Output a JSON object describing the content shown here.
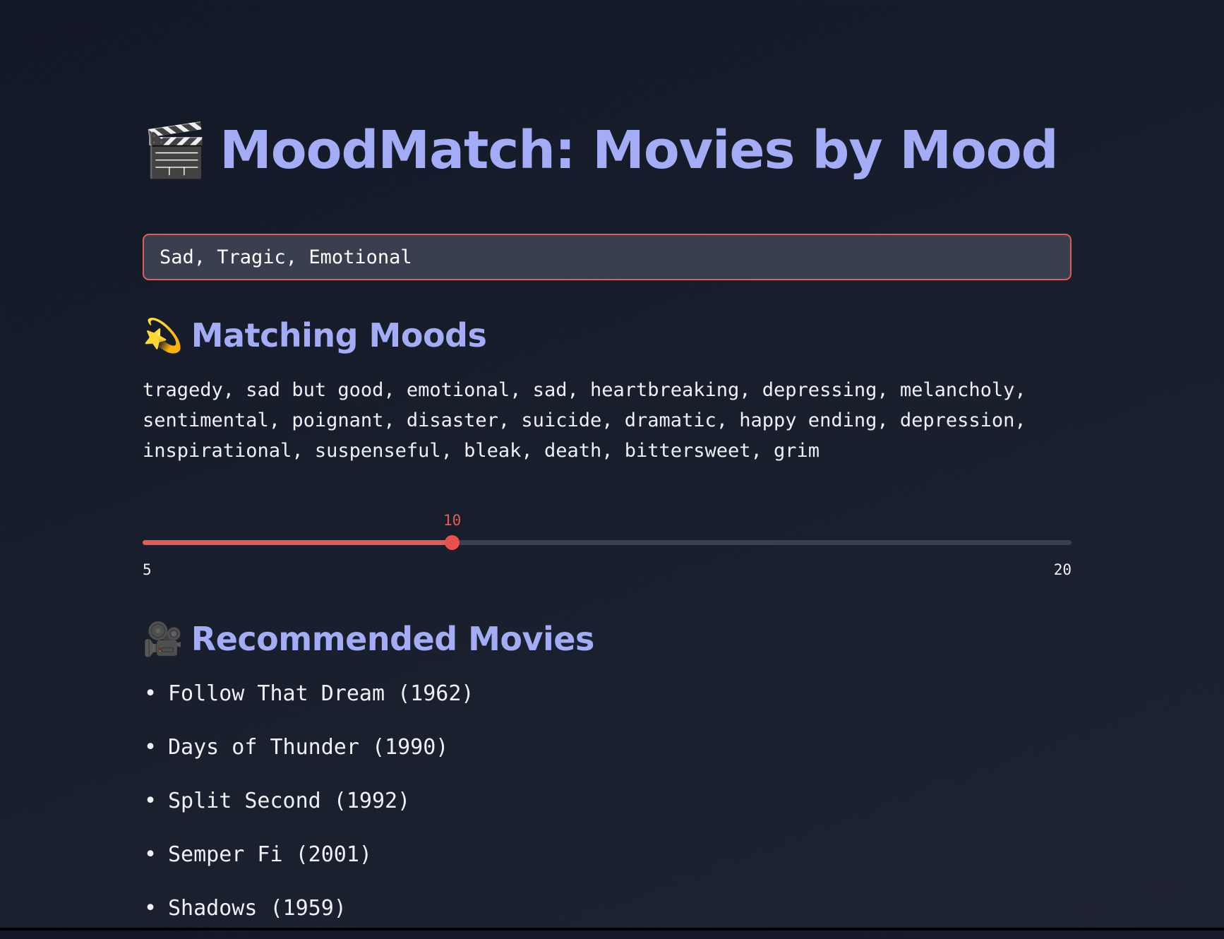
{
  "header": {
    "title_icon": "🎬",
    "title": "MoodMatch: Movies by Mood"
  },
  "search": {
    "value": "Sad, Tragic, Emotional",
    "placeholder": ""
  },
  "matching_moods": {
    "icon": "💫",
    "heading": "Matching Moods",
    "text": "tragedy, sad but good, emotional, sad, heartbreaking, depressing, melancholy, sentimental, poignant, disaster, suicide, dramatic, happy ending, depression, inspirational, suspenseful, bleak, death, bittersweet, grim"
  },
  "slider": {
    "value": 10,
    "value_label": "10",
    "min": 5,
    "min_label": "5",
    "max": 20,
    "max_label": "20"
  },
  "recommended": {
    "icon": "🎥",
    "heading": "Recommended Movies",
    "bullet": "•",
    "movies": [
      "Follow That Dream (1962)",
      "Days of Thunder (1990)",
      "Split Second (1992)",
      "Semper Fi (2001)",
      "Shadows (1959)"
    ]
  },
  "colors": {
    "accent": "#e25c55",
    "heading": "#a3acf5",
    "background": "#181e2c",
    "input_background": "#3a3f50"
  }
}
